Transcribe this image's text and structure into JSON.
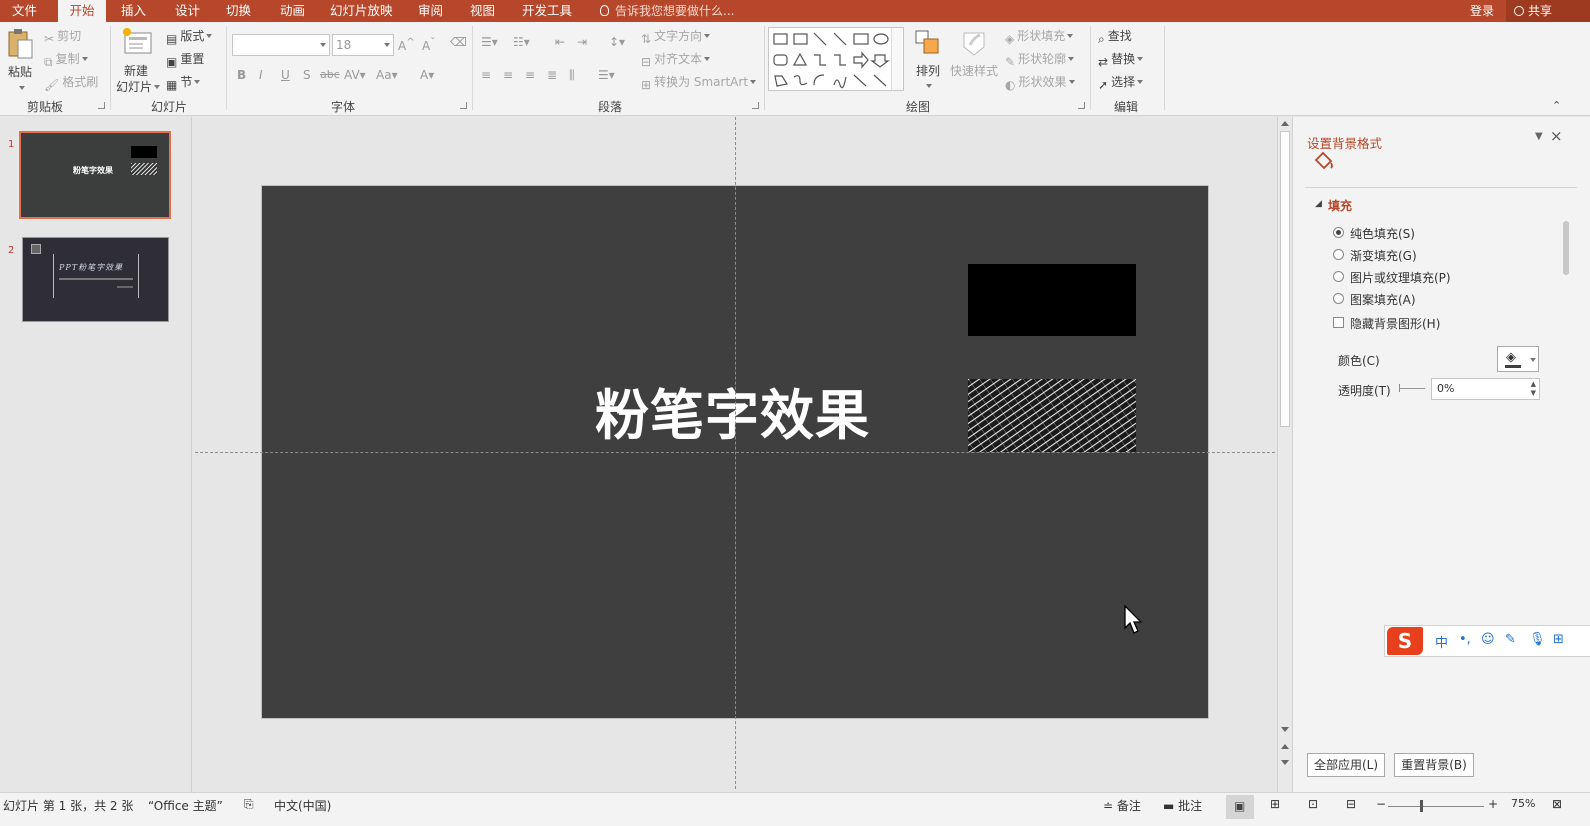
{
  "tabs": [
    {
      "label": "文件"
    },
    {
      "label": "开始"
    },
    {
      "label": "插入"
    },
    {
      "label": "设计"
    },
    {
      "label": "切换"
    },
    {
      "label": "动画"
    },
    {
      "label": "幻灯片放映"
    },
    {
      "label": "审阅"
    },
    {
      "label": "视图"
    },
    {
      "label": "开发工具"
    }
  ],
  "tell_me": "告诉我您想要做什么...",
  "login": "登录",
  "share": "共享",
  "ribbon": {
    "clipboard": {
      "group": "剪贴板",
      "paste": "粘贴",
      "cut": "剪切",
      "copy": "复制",
      "format_painter": "格式刷"
    },
    "slides": {
      "group": "幻灯片",
      "new_slide_line1": "新建",
      "new_slide_line2": "幻灯片",
      "layout": "版式",
      "reset": "重置",
      "section": "节"
    },
    "font": {
      "group": "字体",
      "font_name": "",
      "font_size": "18"
    },
    "paragraph": {
      "group": "段落",
      "text_direction": "文字方向",
      "align_text": "对齐文本",
      "smartart": "转换为 SmartArt"
    },
    "drawing": {
      "group": "绘图",
      "arrange": "排列",
      "quick_styles": "快速样式",
      "shape_fill": "形状填充",
      "shape_outline": "形状轮廓",
      "shape_effects": "形状效果"
    },
    "editing": {
      "group": "编辑",
      "find": "查找",
      "replace": "替换",
      "select": "选择"
    }
  },
  "thumbnails": [
    {
      "number": "1",
      "title": "粉笔字效果"
    },
    {
      "number": "2",
      "title": "PPT粉笔字效果"
    }
  ],
  "slide": {
    "title": "粉笔字效果"
  },
  "pane": {
    "title": "设置背景格式",
    "section": "填充",
    "options": [
      {
        "label": "纯色填充(S)",
        "selected": true
      },
      {
        "label": "渐变填充(G)",
        "selected": false
      },
      {
        "label": "图片或纹理填充(P)",
        "selected": false
      },
      {
        "label": "图案填充(A)",
        "selected": false
      }
    ],
    "hide_bg": "隐藏背景图形(H)",
    "color_label": "颜色(C)",
    "transparency_label": "透明度(T)",
    "transparency_value": "0%",
    "apply_all": "全部应用(L)",
    "reset_bg": "重置背景(B)"
  },
  "status": {
    "slide_info": "幻灯片 第 1 张，共 2 张",
    "theme": "“Office 主题”",
    "language": "中文(中国)",
    "notes": "备注",
    "comments": "批注",
    "zoom": "75%"
  },
  "ime": {
    "mode": "中"
  },
  "colors": {
    "accent": "#b7472a",
    "slide_bg": "#3e3f3e"
  }
}
